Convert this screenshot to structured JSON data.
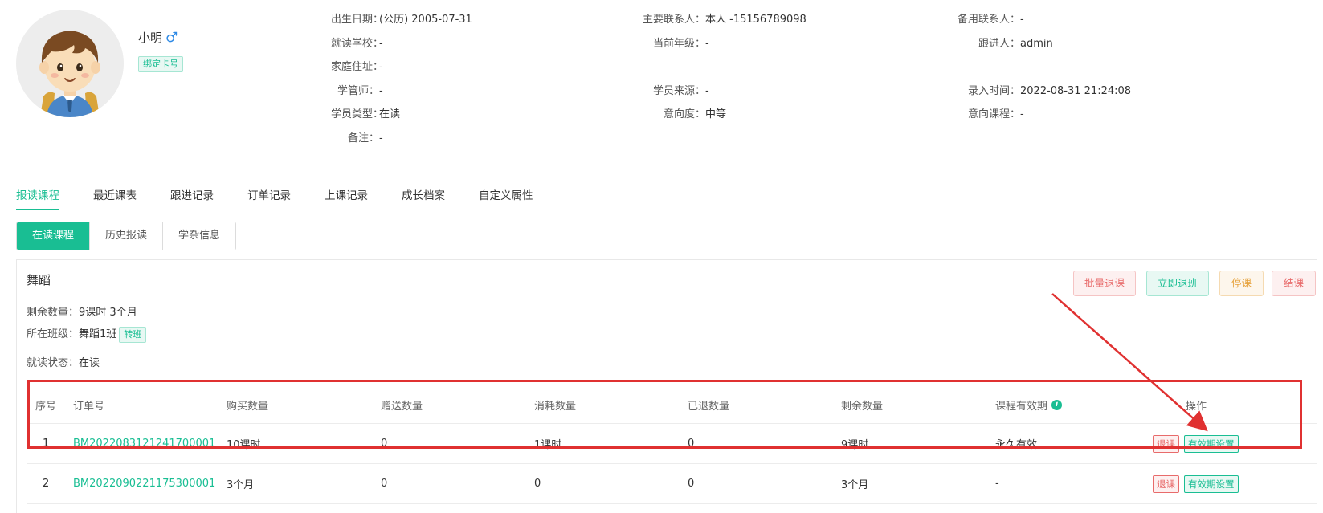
{
  "student": {
    "name": "小明",
    "gender_symbol": "♂",
    "bind_card_label": "绑定卡号"
  },
  "info": {
    "col1": [
      {
        "label": "出生日期：",
        "value": "(公历) 2005-07-31"
      },
      {
        "label": "就读学校：",
        "value": "-"
      },
      {
        "label": "家庭住址：",
        "value": "-"
      },
      {
        "label": "学管师：",
        "value": "-"
      },
      {
        "label": "学员类型：",
        "value": "在读"
      },
      {
        "label": "备注：",
        "value": "-"
      }
    ],
    "col2": [
      {
        "label": "主要联系人：",
        "value": "本人 -15156789098"
      },
      {
        "label": "当前年级：",
        "value": "-"
      },
      {
        "label": "学员来源：",
        "value": "-"
      },
      {
        "label": "意向度：",
        "value": "中等"
      }
    ],
    "col3": [
      {
        "label": "备用联系人：",
        "value": "-"
      },
      {
        "label": "跟进人：",
        "value": "admin"
      },
      {
        "label": "录入时间：",
        "value": "2022-08-31 21:24:08"
      },
      {
        "label": "意向课程：",
        "value": "-"
      }
    ]
  },
  "tabs": [
    "报读课程",
    "最近课表",
    "跟进记录",
    "订单记录",
    "上课记录",
    "成长档案",
    "自定义属性"
  ],
  "subtabs": [
    "在读课程",
    "历史报读",
    "学杂信息"
  ],
  "course": {
    "title": "舞蹈",
    "remaining_label": "剩余数量：",
    "remaining_value": "9课时 3个月",
    "class_label": "所在班级：",
    "class_value": "舞蹈1班",
    "switch_class_label": "转班",
    "status_label": "就读状态：",
    "status_value": "在读",
    "actions": {
      "batch_withdraw": "批量退课",
      "quit_class": "立即退班",
      "pause": "停课",
      "finish": "结课"
    }
  },
  "table": {
    "headers": [
      "序号",
      "订单号",
      "购买数量",
      "赠送数量",
      "消耗数量",
      "已退数量",
      "剩余数量",
      "课程有效期",
      "操作"
    ],
    "rows": [
      {
        "no": "1",
        "order": "BM2022083121241700001",
        "buy": "10课时",
        "gift": "0",
        "used": "1课时",
        "returned": "0",
        "left": "9课时",
        "validity": "永久有效"
      },
      {
        "no": "2",
        "order": "BM2022090221175300001",
        "buy": "3个月",
        "gift": "0",
        "used": "0",
        "returned": "0",
        "left": "3个月",
        "validity": "-"
      }
    ],
    "row_action_refund": "退课",
    "row_action_validity": "有效期设置"
  },
  "colors": {
    "accent": "#19be93",
    "danger": "#e86b6b",
    "warning": "#e6a23c",
    "annotation_red": "#e03131"
  }
}
